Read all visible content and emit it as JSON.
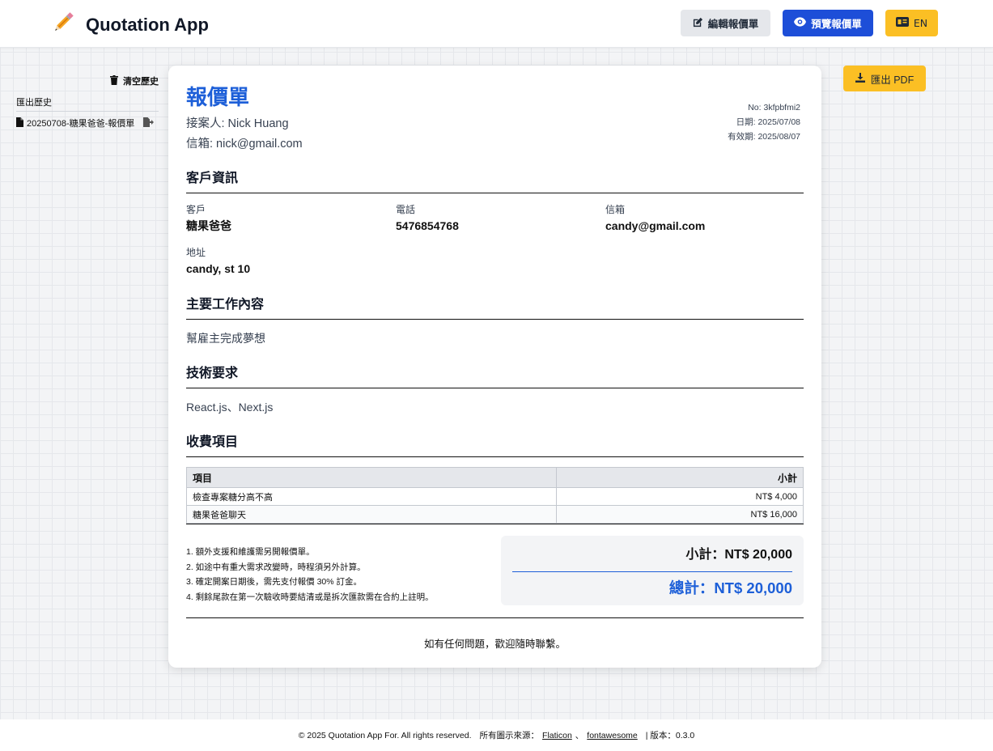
{
  "header": {
    "app_title": "Quotation App",
    "edit_label": "編輯報價單",
    "preview_label": "預覽報價單",
    "lang_label": "EN",
    "logo_icon": "pencil-icon"
  },
  "sidebar": {
    "clear_label": "清空歷史",
    "history_title": "匯出歷史",
    "items": [
      {
        "name": "20250708-糖果爸爸-報價單"
      }
    ]
  },
  "quote": {
    "title": "報價單",
    "contact_name": "接案人: Nick Huang",
    "contact_email": "信箱: nick@gmail.com",
    "no": "No: 3kfpbfmi2",
    "date": "日期: 2025/07/08",
    "valid_until": "有效期: 2025/08/07"
  },
  "client": {
    "section_title": "客戶資訊",
    "name_label": "客戶",
    "name": "糖果爸爸",
    "phone_label": "電話",
    "phone": "5476854768",
    "email_label": "信箱",
    "email": "candy@gmail.com",
    "address_label": "地址",
    "address": "candy, st 10"
  },
  "work": {
    "section_title": "主要工作內容",
    "content": "幫雇主完成夢想"
  },
  "tech": {
    "section_title": "技術要求",
    "content": "React.js、Next.js"
  },
  "fees": {
    "section_title": "收費項目",
    "col_item": "項目",
    "col_subtotal": "小計",
    "rows": [
      {
        "item": "檢查專案糖分高不高",
        "amount": "NT$ 4,000"
      },
      {
        "item": "糖果爸爸聊天",
        "amount": "NT$ 16,000"
      }
    ]
  },
  "notes": [
    "1. 額外支援和維護需另開報價單。",
    "2. 如途中有重大需求改變時，時程須另外計算。",
    "3. 確定開案日期後，需先支付報價 30% 訂金。",
    "4. 剩餘尾款在第一次驗收時要結清或是拆次匯款需在合約上註明。"
  ],
  "totals": {
    "subtotal": "小計：NT$ 20,000",
    "total": "總計：NT$ 20,000"
  },
  "closing": "如有任何問題，歡迎隨時聯繫。",
  "export_pdf_label": "匯出 PDF",
  "footer": {
    "copyright": "© 2025 Quotation App For. All rights reserved.",
    "icons_prefix": "所有圖示來源：",
    "link_flaticon": "Flaticon",
    "separator": "、",
    "link_fontawesome": "fontawesome",
    "version": "| 版本：0.3.0"
  },
  "colors": {
    "accent_blue": "#1d5fd8",
    "button_blue": "#1d4ed8",
    "button_yellow": "#fbbf24"
  }
}
